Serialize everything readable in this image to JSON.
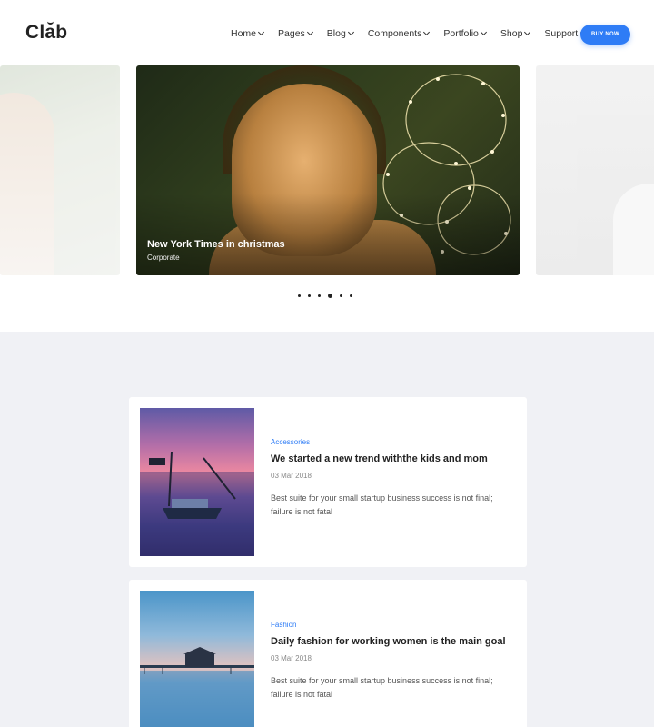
{
  "header": {
    "logo": "Clab",
    "nav": [
      "Home",
      "Pages",
      "Blog",
      "Components",
      "Portfolio",
      "Shop",
      "Support"
    ],
    "buy_label": "BUY NOW",
    "accent_color": "#2e7cf6"
  },
  "slider": {
    "active_slide": {
      "title": "New York Times in christmas",
      "category": "Corporate"
    },
    "dots": 6,
    "active_dot": 4
  },
  "posts": [
    {
      "category": "Accessories",
      "title": "We started a new trend withthe kids and mom",
      "date": "03 Mar 2018",
      "excerpt": "Best suite for your small startup business success is not final; failure is not fatal"
    },
    {
      "category": "Fashion",
      "title": "Daily fashion for working women is the main goal",
      "date": "03 Mar 2018",
      "excerpt": "Best suite for your small startup business success is not final; failure is not fatal"
    }
  ]
}
